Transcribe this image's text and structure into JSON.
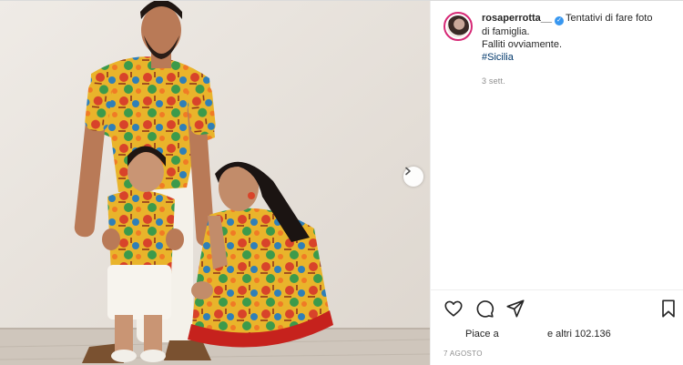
{
  "post": {
    "username": "rosaperrotta__",
    "caption_lines": [
      "Tentativi di fare foto",
      "di famiglia.",
      "Falliti ovviamente."
    ],
    "hashtag": "#Sicilia",
    "time_ago": "3 sett.",
    "likes_prefix": "Piace a",
    "likes_suffix": "e altri 102.136",
    "date": "7 AGOSTO"
  },
  "icons": {
    "verified": "verified-badge-icon",
    "like": "heart-icon",
    "comment": "comment-icon",
    "share": "paper-plane-icon",
    "save": "bookmark-icon",
    "next": "chevron-right-icon"
  },
  "colors": {
    "verified": "#3897f0",
    "hashtag": "#00376b",
    "text": "#262626",
    "muted": "#8e8e8e",
    "avatar_ring": "#d62976"
  }
}
